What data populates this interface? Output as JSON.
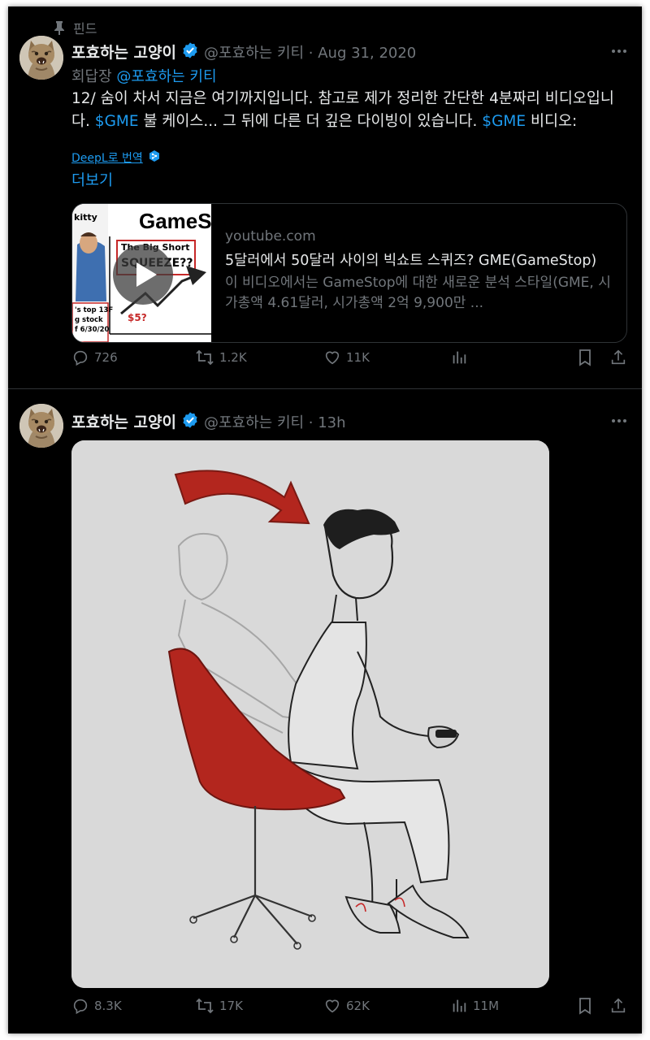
{
  "pinned_label": "핀드",
  "tweets": [
    {
      "display_name": "포효하는 고양이",
      "handle_time": "@포효하는 키티 · Aug 31, 2020",
      "replying_prefix": "회답장",
      "replying_to": "@포효하는 키티",
      "text": {
        "p1": "12/ 숨이 차서 지금은 여기까지입니다. 참고로 제가 정리한 간단한 4분짜리 비디오입니다. ",
        "tag1": "$GME",
        "p2": " 불 케이스... 그 뒤에 다른 더 깊은 다이빙이 있습니다. ",
        "tag2": "$GME",
        "p3": " 비디오:"
      },
      "translate_label": "DeepL로 번역",
      "show_more": "더보기",
      "card": {
        "domain": "youtube.com",
        "title": "5달러에서 50달러 사이의 빅쇼트 스퀴즈? GME(GameStop)",
        "description": "이 비디오에서는 GameStop에 대한 새로운 분석 스타일(GME, 시가총액 4.61달러, 시가총액 2억 9,900만 ...",
        "thumb": {
          "kitty": "kitty",
          "brand": "GameS",
          "big_short": "The Big Short",
          "squeeze": "SQUEEZE??",
          "price": "$5?",
          "note1": "'s top 13F",
          "note2": "g stock",
          "note3": "f 6/30/20"
        }
      },
      "stats": {
        "replies": "726",
        "retweets": "1.2K",
        "likes": "11K",
        "views": ""
      }
    },
    {
      "display_name": "포효하는 고양이",
      "handle_time": "@포효하는 키티 · 13h",
      "stats": {
        "replies": "8.3K",
        "retweets": "17K",
        "likes": "62K",
        "views": "11M"
      }
    }
  ],
  "colors": {
    "background": "#000000",
    "accent": "#1d9bf0",
    "muted": "#71767b",
    "text": "#e7e9ea",
    "verified": "#1d9bf0",
    "chair_red": "#b3261e"
  },
  "icons": [
    "pin-icon",
    "verified-badge-icon",
    "more-icon",
    "reply-icon",
    "retweet-icon",
    "like-icon",
    "views-icon",
    "bookmark-icon",
    "share-icon",
    "play-icon",
    "deepl-icon"
  ]
}
